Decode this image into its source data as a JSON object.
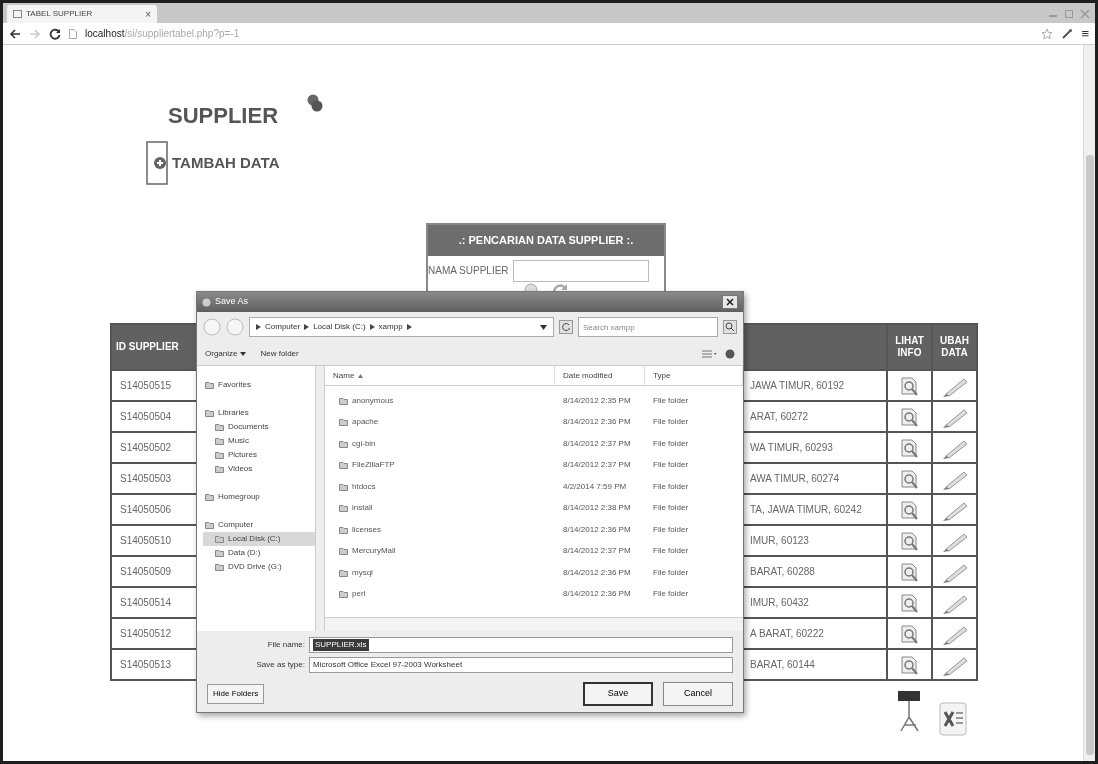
{
  "browser": {
    "tab": {
      "title": "TABEL SUPPLIER",
      "close": "×"
    },
    "url": {
      "host": "localhost",
      "path": "/si/suppliertabel.php?p=-1"
    },
    "menu": "≡"
  },
  "page": {
    "title": "SUPPLIER",
    "add_button": "TAMBAH DATA",
    "search_panel": {
      "title": ".: PENCARIAN DATA SUPPLIER :.",
      "label": "NAMA SUPPLIER"
    },
    "table": {
      "header": {
        "id": "ID SUPPLIER",
        "view": "LIHAT INFO",
        "edit": "UBAH DATA"
      },
      "rows": [
        {
          "id": "S14050515",
          "column_3": "JAWA TIMUR, 60192"
        },
        {
          "id": "S14050504",
          "column_3": "ARAT, 60272"
        },
        {
          "id": "S14050502",
          "column_3": "WA TIMUR, 60293"
        },
        {
          "id": "S14050503",
          "column_3": "AWA TIMUR, 60274"
        },
        {
          "id": "S14050506",
          "column_3": "TA, JAWA TIMUR, 60242"
        },
        {
          "id": "S14050510",
          "column_3": "IMUR, 60123"
        },
        {
          "id": "S14050509",
          "column_3": "BARAT, 60288"
        },
        {
          "id": "S14050514",
          "column_3": "IMUR, 60432"
        },
        {
          "id": "S14050512",
          "column_3": "A BARAT, 60222"
        },
        {
          "id": "S14050513",
          "column_3": "BARAT, 60144"
        }
      ]
    }
  },
  "save_dialog": {
    "title": "Save As",
    "breadcrumb": [
      "Computer",
      "Local Disk (C:)",
      "xampp"
    ],
    "search": {
      "placeholder": "Search xampp"
    },
    "toolbar": [
      "Organize",
      "New folder"
    ],
    "nav": [
      {
        "label": "Favorites",
        "selected": false
      },
      {
        "label": "Libraries",
        "selected": false,
        "children": [
          {
            "label": "Documents",
            "selected": false
          },
          {
            "label": "Music",
            "selected": false
          },
          {
            "label": "Pictures",
            "selected": false
          },
          {
            "label": "Videos",
            "selected": false
          }
        ]
      },
      {
        "label": "Homegroup",
        "selected": false
      },
      {
        "label": "Computer",
        "selected": false,
        "children": [
          {
            "label": "Local Disk (C:)",
            "selected": true
          },
          {
            "label": "Data (D:)",
            "selected": false
          },
          {
            "label": "DVD Drive (G:)",
            "selected": false
          }
        ]
      }
    ],
    "files": {
      "columns": [
        "Name",
        "Date modified",
        "Type"
      ],
      "rows": [
        {
          "name": "anonymous",
          "date": "8/14/2012 2:35 PM",
          "type": "File folder"
        },
        {
          "name": "apache",
          "date": "8/14/2012 2:36 PM",
          "type": "File folder"
        },
        {
          "name": "cgi-bin",
          "date": "8/14/2012 2:37 PM",
          "type": "File folder"
        },
        {
          "name": "FileZillaFTP",
          "date": "8/14/2012 2:37 PM",
          "type": "File folder"
        },
        {
          "name": "htdocs",
          "date": "4/2/2014 7:59 PM",
          "type": "File folder"
        },
        {
          "name": "install",
          "date": "8/14/2012 2:38 PM",
          "type": "File folder"
        },
        {
          "name": "licenses",
          "date": "8/14/2012 2:36 PM",
          "type": "File folder"
        },
        {
          "name": "MercuryMail",
          "date": "8/14/2012 2:37 PM",
          "type": "File folder"
        },
        {
          "name": "mysql",
          "date": "8/14/2012 2:36 PM",
          "type": "File folder"
        },
        {
          "name": "perl",
          "date": "8/14/2012 2:36 PM",
          "type": "File folder"
        }
      ]
    },
    "file_name": {
      "label": "File name:",
      "value": "SUPPLIER.xls"
    },
    "save_type": {
      "label": "Save as type:",
      "value": "Microsoft Office Excel 97-2003 Worksheet"
    },
    "hide_folders": "Hide Folders",
    "buttons": [
      "Save",
      "Cancel"
    ]
  }
}
